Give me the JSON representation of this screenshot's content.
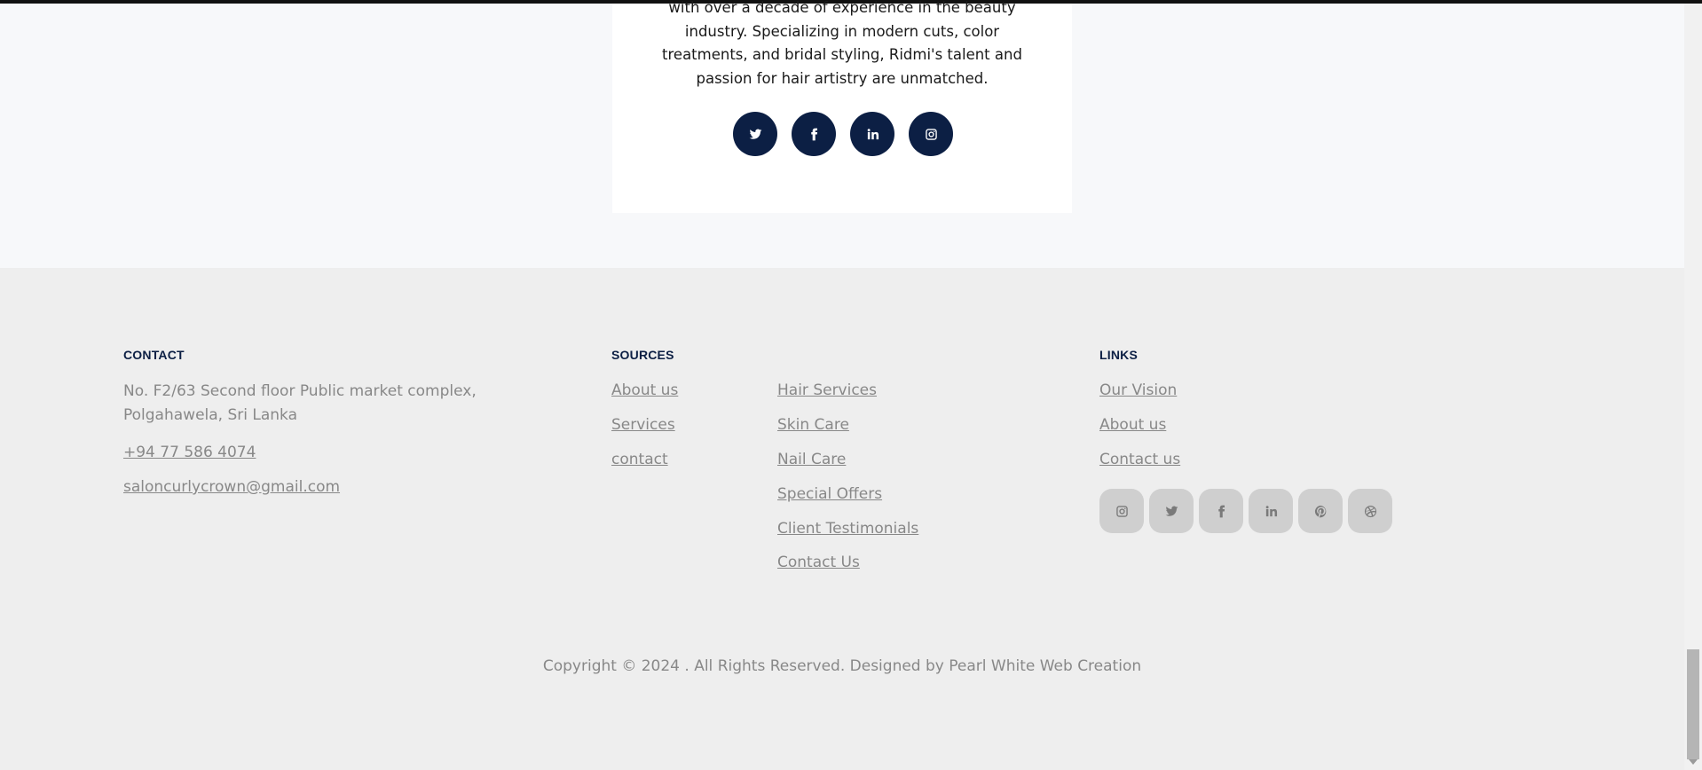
{
  "profile": {
    "bio": "with over a decade of experience in the beauty industry. Specializing in modern cuts, color treatments, and bridal styling, Ridmi's talent and passion for hair artistry are unmatched.",
    "social_icons": [
      "twitter-icon",
      "facebook-icon",
      "linkedin-icon",
      "instagram-icon"
    ]
  },
  "footer": {
    "contact": {
      "title": "CONTACT",
      "address": "No. F2/63 Second floor Public market complex, Polgahawela, Sri Lanka",
      "phone": "+94 77 586 4074",
      "email": "saloncurlycrown@gmail.com"
    },
    "sources": {
      "title": "SOURCES",
      "col1": [
        "About us",
        "Services",
        "contact"
      ],
      "col2": [
        "Hair Services",
        "Skin Care",
        "Nail Care",
        "Special Offers",
        "Client Testimonials",
        "Contact Us"
      ]
    },
    "links": {
      "title": "LINKS",
      "items": [
        "Our Vision",
        "About us",
        "Contact us"
      ],
      "social_icons": [
        "instagram-icon",
        "twitter-icon",
        "facebook-icon",
        "linkedin-icon",
        "pinterest-icon",
        "dribbble-icon"
      ]
    },
    "copyright": "Copyright © 2024 . All Rights Reserved. Designed by Pearl White Web Creation"
  },
  "colors": {
    "navy": "#0c1f44",
    "footer_bg": "#eeeeee",
    "muted_text": "#888888"
  }
}
